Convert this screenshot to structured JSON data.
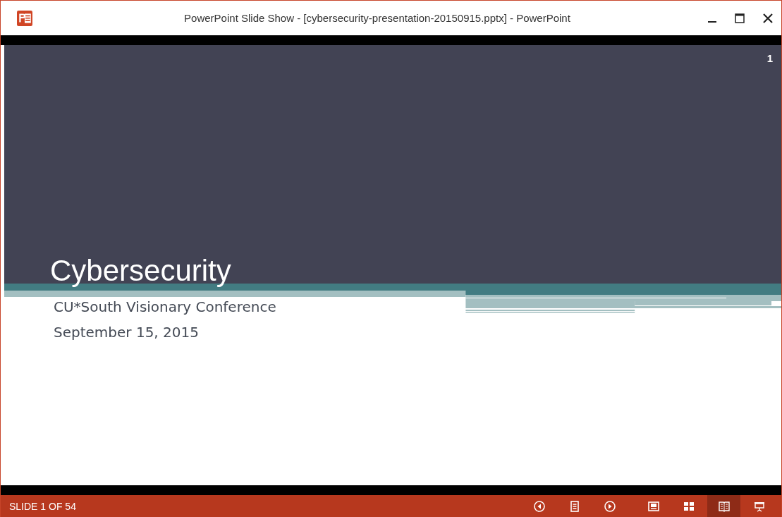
{
  "window": {
    "title": "PowerPoint Slide Show - [cybersecurity-presentation-20150915.pptx] - PowerPoint"
  },
  "slide": {
    "number": "1",
    "title": "Cybersecurity",
    "subtitle_lines": [
      "CU*South Visionary Conference",
      "September 15, 2015"
    ]
  },
  "status_bar": {
    "slide_counter": "SLIDE 1 OF 54",
    "buttons": [
      {
        "kind": "previous",
        "selected": false
      },
      {
        "kind": "notes",
        "selected": false
      },
      {
        "kind": "next",
        "selected": false
      },
      {
        "kind": "normal",
        "selected": false
      },
      {
        "kind": "sorter",
        "selected": false
      },
      {
        "kind": "reading",
        "selected": true
      },
      {
        "kind": "slideshow",
        "selected": false
      }
    ]
  }
}
